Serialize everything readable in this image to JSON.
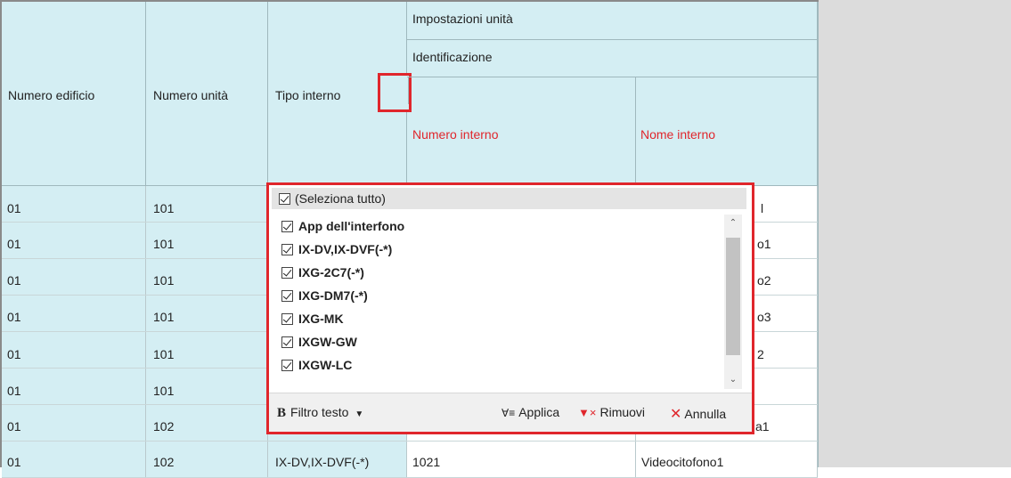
{
  "headers": {
    "building_number": "Numero edificio",
    "unit_number": "Numero unità",
    "station_type": "Tipo interno",
    "unit_settings": "Impostazioni unità",
    "identification": "Identificazione",
    "station_number": "Numero interno",
    "station_name": "Nome interno"
  },
  "rows": [
    {
      "building": "01",
      "unit": "101",
      "type": "",
      "number": "",
      "name": "l"
    },
    {
      "building": "01",
      "unit": "101",
      "type": "",
      "number": "",
      "name": "o1"
    },
    {
      "building": "01",
      "unit": "101",
      "type": "",
      "number": "",
      "name": "o2"
    },
    {
      "building": "01",
      "unit": "101",
      "type": "",
      "number": "",
      "name": "o3"
    },
    {
      "building": "01",
      "unit": "101",
      "type": "",
      "number": "",
      "name": "2"
    },
    {
      "building": "01",
      "unit": "101",
      "type": "",
      "number": "",
      "name": ""
    },
    {
      "building": "01",
      "unit": "102",
      "type": "",
      "number": "",
      "name": "a1"
    },
    {
      "building": "01",
      "unit": "102",
      "type": "IX-DV,IX-DVF(-*)",
      "number": "1021",
      "name": "Videocitofono1"
    }
  ],
  "filter_popup": {
    "select_all": "(Seleziona tutto)",
    "items": [
      "App dell'interfono",
      "IX-DV,IX-DVF(-*)",
      "IXG-2C7(-*)",
      "IXG-DM7(-*)",
      "IXG-MK",
      "IXGW-GW",
      "IXGW-LC"
    ],
    "text_filter_label": "Filtro testo",
    "apply_label": "Applica",
    "remove_label": "Rimuovi",
    "cancel_label": "Annulla"
  },
  "colors": {
    "header_bg": "#d4eef3",
    "highlight_red": "#e0262c",
    "right_panel_bg": "#dcdcdc"
  }
}
